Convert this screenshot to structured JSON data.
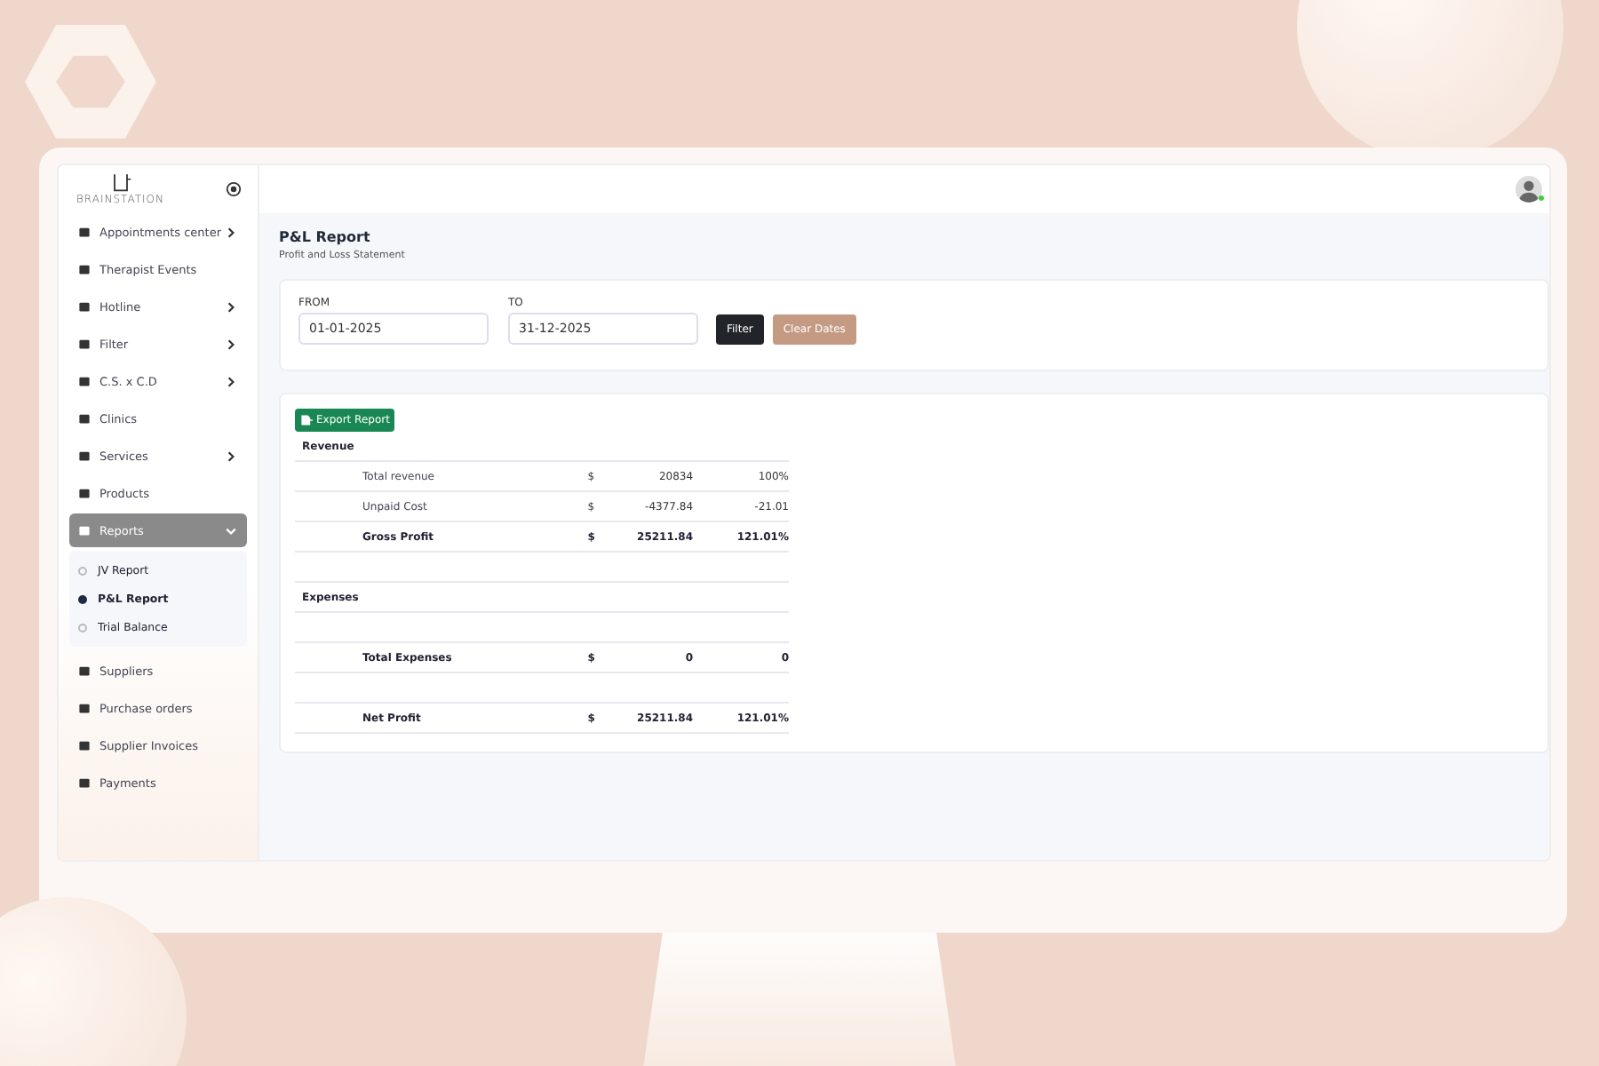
{
  "logo": {
    "text": "BRAINSTATION"
  },
  "sidebar": {
    "items": [
      {
        "label": "Appointments center",
        "expanded": false,
        "selected": false
      },
      {
        "label": "Therapist Events",
        "selected": false
      },
      {
        "label": "Hotline",
        "expanded": false,
        "selected": false
      },
      {
        "label": "Filter",
        "expanded": false,
        "selected": false
      },
      {
        "label": "C.S. x C.D",
        "expanded": false,
        "selected": false
      },
      {
        "label": "Clinics",
        "selected": false
      },
      {
        "label": "Services",
        "expanded": false,
        "selected": false
      },
      {
        "label": "Products",
        "selected": false
      },
      {
        "label": "Reports",
        "expanded": true,
        "selected": true,
        "children": [
          {
            "label": "JV Report",
            "selected": false
          },
          {
            "label": "P&L Report",
            "selected": true
          },
          {
            "label": "Trial Balance",
            "selected": false
          }
        ]
      },
      {
        "label": "Suppliers",
        "selected": false
      },
      {
        "label": "Purchase orders",
        "selected": false
      },
      {
        "label": "Supplier Invoices",
        "selected": false
      },
      {
        "label": "Payments",
        "selected": false
      }
    ]
  },
  "page": {
    "title": "P&L Report",
    "subtitle": "Profit and Loss Statement"
  },
  "filters": {
    "from": {
      "label": "FROM",
      "value": "01-01-2025"
    },
    "to": {
      "label": "TO",
      "value": "31-12-2025"
    },
    "buttons": [
      "Filter",
      "Clear Dates"
    ]
  },
  "report": {
    "export_button": "Export Report",
    "rows": [
      {
        "kind": "section",
        "label": "Revenue"
      },
      {
        "kind": "line",
        "label": "Total revenue",
        "currency": "$",
        "amount": "20834",
        "percent": "100%"
      },
      {
        "kind": "line",
        "label": "Unpaid Cost",
        "currency": "$",
        "amount": "-4377.84",
        "percent": "-21.01"
      },
      {
        "kind": "total",
        "label": "Gross Profit",
        "currency": "$",
        "amount": "25211.84",
        "percent": "121.01%"
      },
      {
        "kind": "blank"
      },
      {
        "kind": "section",
        "label": "Expenses"
      },
      {
        "kind": "blank"
      },
      {
        "kind": "total",
        "label": "Total Expenses",
        "currency": "$",
        "amount": "0",
        "percent": "0"
      },
      {
        "kind": "blank"
      },
      {
        "kind": "total",
        "label": "Net Profit",
        "currency": "$",
        "amount": "25211.84",
        "percent": "121.01%"
      }
    ]
  }
}
